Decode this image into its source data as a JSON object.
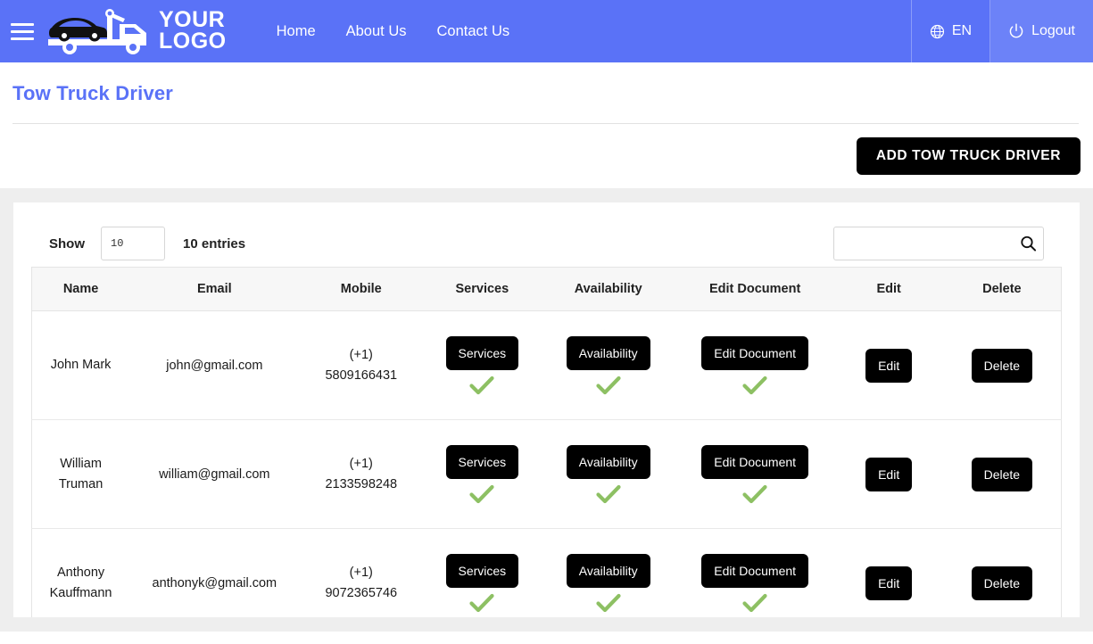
{
  "navbar": {
    "menu_icon": "hamburger-menu-icon",
    "logo": {
      "icon": "tow-truck-icon",
      "line1": "YOUR",
      "line2": "LOGO"
    },
    "links": [
      {
        "label": "Home"
      },
      {
        "label": "About Us"
      },
      {
        "label": "Contact Us"
      }
    ],
    "language": {
      "icon": "globe-icon",
      "label": "EN"
    },
    "logout": {
      "icon": "power-icon",
      "label": "Logout"
    },
    "background_color": "#5a72f7"
  },
  "page": {
    "title": "Tow Truck Driver",
    "title_color": "#5a72f7",
    "add_button": "ADD TOW TRUCK DRIVER"
  },
  "table_controls": {
    "show_label": "Show",
    "length_value": "10",
    "entries_label": "10 entries",
    "search_value": "",
    "search_placeholder": "",
    "search_icon": "search-icon"
  },
  "table": {
    "columns": [
      "Name",
      "Email",
      "Mobile",
      "Services",
      "Availability",
      "Edit Document",
      "Edit",
      "Delete"
    ],
    "check_color": "#8dc063",
    "rows": [
      {
        "name": "John Mark",
        "email": "john@gmail.com",
        "mobile_code": "(+1)",
        "mobile_number": "5809166431",
        "services_label": "Services",
        "services_checked": true,
        "availability_label": "Availability",
        "availability_checked": true,
        "document_label": "Edit Document",
        "document_checked": true,
        "edit_label": "Edit",
        "delete_label": "Delete"
      },
      {
        "name": "William Truman",
        "email": "william@gmail.com",
        "mobile_code": "(+1)",
        "mobile_number": "2133598248",
        "services_label": "Services",
        "services_checked": true,
        "availability_label": "Availability",
        "availability_checked": true,
        "document_label": "Edit Document",
        "document_checked": true,
        "edit_label": "Edit",
        "delete_label": "Delete"
      },
      {
        "name": "Anthony Kauffmann",
        "email": "anthonyk@gmail.com",
        "mobile_code": "(+1)",
        "mobile_number": "9072365746",
        "services_label": "Services",
        "services_checked": true,
        "availability_label": "Availability",
        "availability_checked": true,
        "document_label": "Edit Document",
        "document_checked": true,
        "edit_label": "Edit",
        "delete_label": "Delete"
      }
    ]
  }
}
